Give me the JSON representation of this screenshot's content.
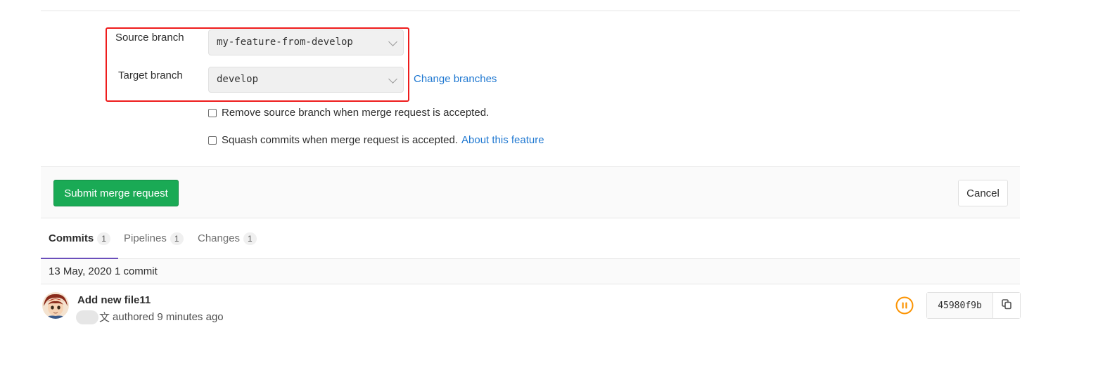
{
  "form": {
    "source_label": "Source branch",
    "source_value": "my-feature-from-develop",
    "target_label": "Target branch",
    "target_value": "develop",
    "change_branches": "Change branches",
    "remove_source_label": "Remove source branch when merge request is accepted.",
    "squash_label": "Squash commits when merge request is accepted.",
    "about_feature": "About this feature"
  },
  "actions": {
    "submit_label": "Submit merge request",
    "cancel_label": "Cancel"
  },
  "tabs": [
    {
      "label": "Commits",
      "count": "1"
    },
    {
      "label": "Pipelines",
      "count": "1"
    },
    {
      "label": "Changes",
      "count": "1"
    }
  ],
  "commits": {
    "date_header": "13 May, 2020 1 commit",
    "items": [
      {
        "title": "Add new file11",
        "author_suffix": "文",
        "meta": "authored 9 minutes ago",
        "sha": "45980f9b",
        "pipeline_status_icon": "pipeline-paused-icon"
      }
    ]
  },
  "colors": {
    "submit_green": "#1aaa55",
    "link_blue": "#1f78d1",
    "highlight_red": "#ee1c1c",
    "active_tab_purple": "#6b4fbb",
    "pipeline_orange": "#fc9403"
  }
}
